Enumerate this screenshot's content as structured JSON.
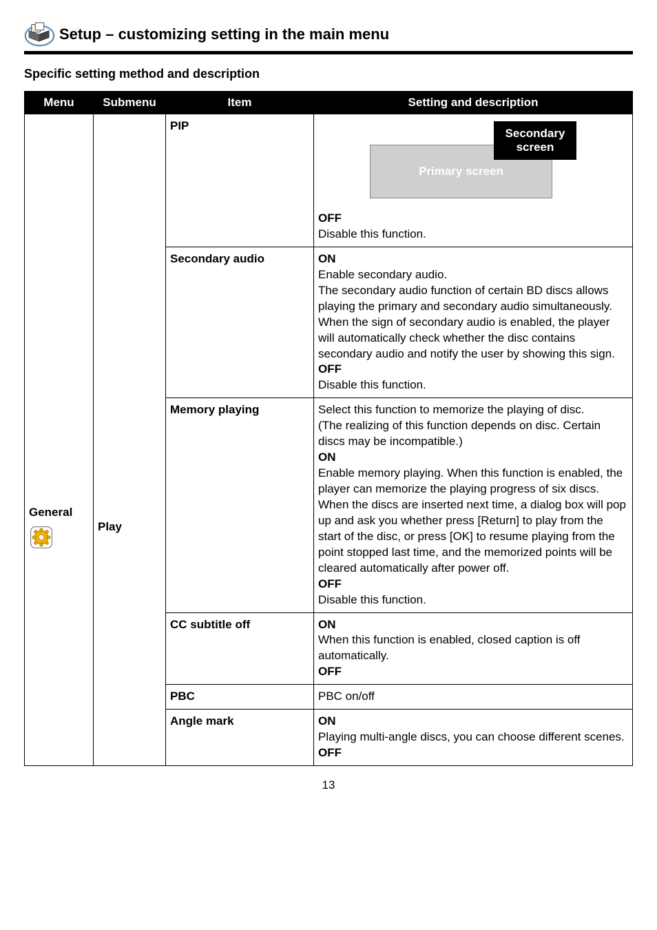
{
  "header": {
    "title": "Setup – customizing setting in the main menu"
  },
  "section_title": "Specific setting method and description",
  "columns": {
    "c1": "Menu",
    "c2": "Submenu",
    "c3": "Item",
    "c4": "Setting and description"
  },
  "menu": "General",
  "submenu": "Play",
  "rows": {
    "pip": {
      "item": "PIP",
      "secondary_label": "Secondary screen",
      "primary_label": "Primary screen",
      "off": "OFF",
      "off_desc": "Disable this function."
    },
    "secaudio": {
      "item": "Secondary audio",
      "on": "ON",
      "on_desc1": "Enable secondary audio.",
      "on_desc2": "The secondary audio function of certain BD discs allows playing the primary and secondary audio simultaneously. When the sign of secondary audio is enabled, the player will automatically check whether the disc contains secondary audio and notify the user by showing this sign.",
      "off": "OFF",
      "off_desc": "Disable this function."
    },
    "memory": {
      "item": "Memory playing",
      "intro1": "Select this function to memorize the playing of disc.",
      "intro2": "(The realizing of this function depends on disc. Certain discs may be incompatible.)",
      "on": "ON",
      "on_desc": "Enable memory playing. When this function is enabled, the player can memorize the playing progress of six discs. When the discs are inserted next time, a dialog box will pop up and ask you whether press [Return] to play from the start of the disc, or press [OK] to resume playing from the point stopped last time, and the memorized points will be cleared automatically after power off.",
      "off": "OFF",
      "off_desc": "Disable this function."
    },
    "cc": {
      "item": "CC subtitle off",
      "on": "ON",
      "on_desc": "When this function is enabled, closed caption is off automatically.",
      "off": "OFF"
    },
    "pbc": {
      "item": "PBC",
      "desc": "PBC on/off"
    },
    "angle": {
      "item": "Angle mark",
      "on": "ON",
      "on_desc": "Playing multi-angle discs, you can choose different scenes.",
      "off": "OFF"
    }
  },
  "page_number": "13"
}
